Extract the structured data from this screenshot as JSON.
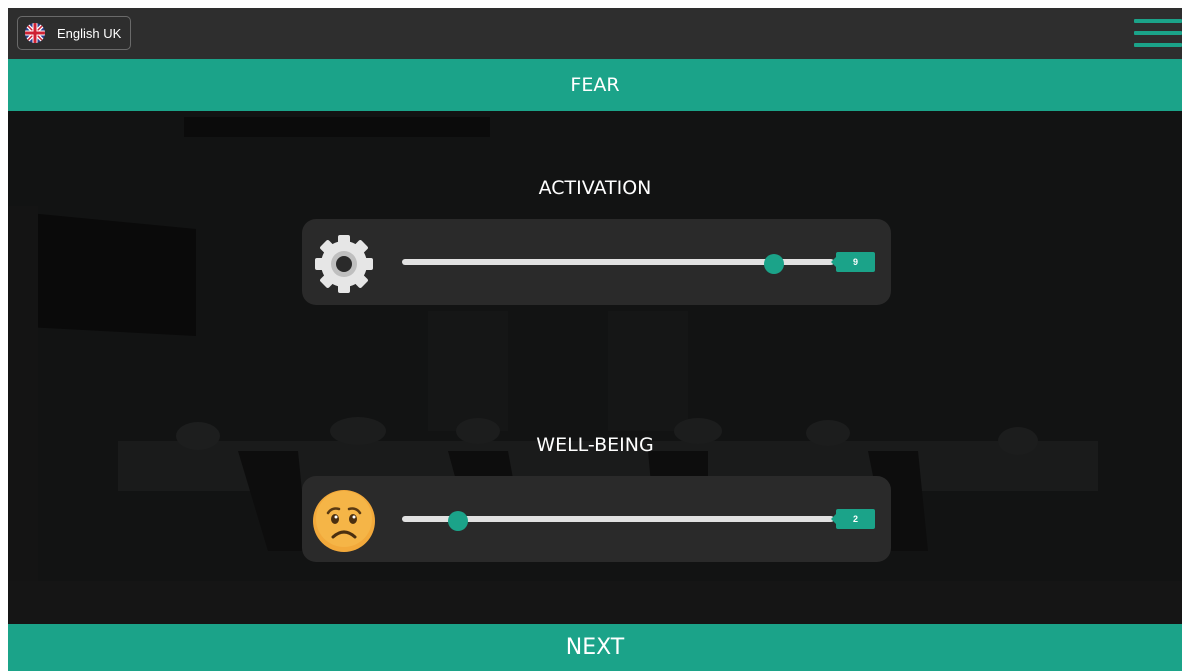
{
  "header": {
    "language_label": "English UK",
    "language_icon": "uk-flag-icon",
    "menu_icon": "hamburger-menu-icon"
  },
  "title": "FEAR",
  "sliders": [
    {
      "label": "ACTIVATION",
      "icon": "gear-icon",
      "value": "9",
      "fill_fraction": 0.86
    },
    {
      "label": "WELL-BEING",
      "icon": "sad-face-icon",
      "value": "2",
      "fill_fraction": 0.13
    }
  ],
  "footer": {
    "next_label": "NEXT"
  },
  "colors": {
    "accent": "#1ba389",
    "topbar": "#2e2e2e",
    "card": "#2a2a2a",
    "track": "#e1e1e1"
  }
}
